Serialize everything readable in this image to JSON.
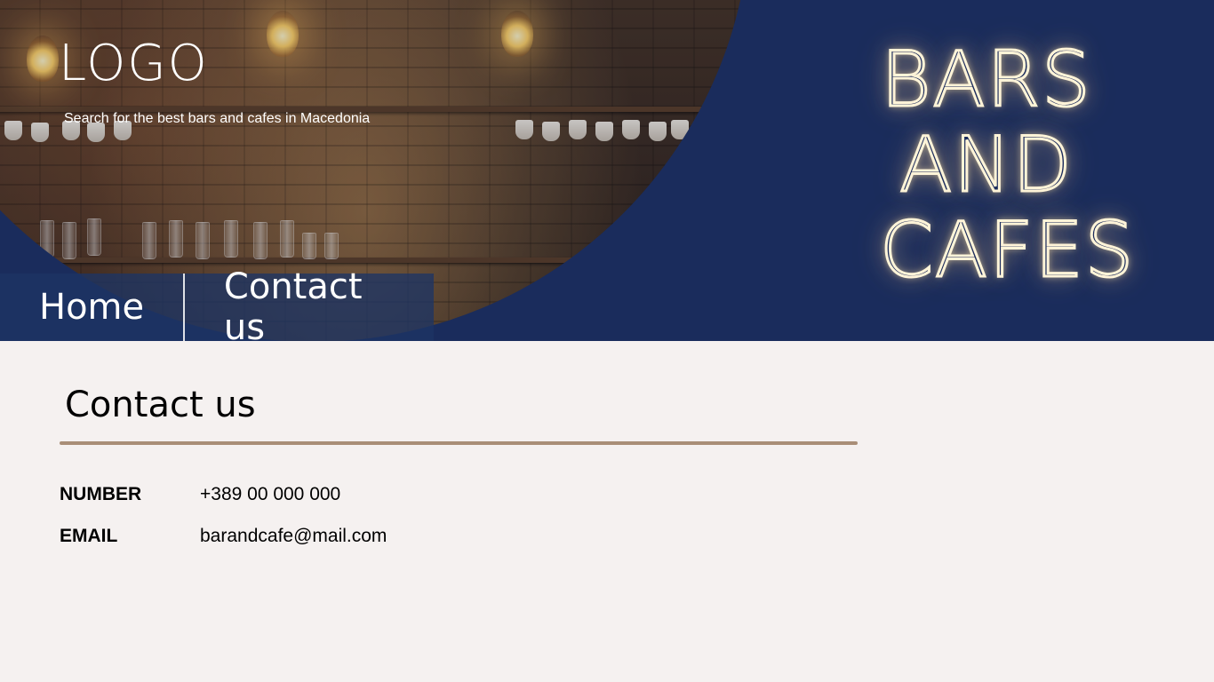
{
  "header": {
    "logo": "LOGO",
    "tagline": "Search for the best bars and cafes in Macedonia",
    "neon_sign": [
      "BARS",
      "AND",
      "CAFES"
    ]
  },
  "nav": {
    "items": [
      {
        "label": "Home"
      },
      {
        "label": "Contact us"
      }
    ]
  },
  "main": {
    "title": "Contact us",
    "contacts": [
      {
        "label": "NUMBER",
        "value": "+389 00 000 000"
      },
      {
        "label": "EMAIL",
        "value": "barandcafe@mail.com"
      }
    ]
  },
  "colors": {
    "hero_bg": "#1a2c5c",
    "page_bg": "#f5f1f0",
    "divider": "#a98e77",
    "neon": "#fff4d8"
  }
}
